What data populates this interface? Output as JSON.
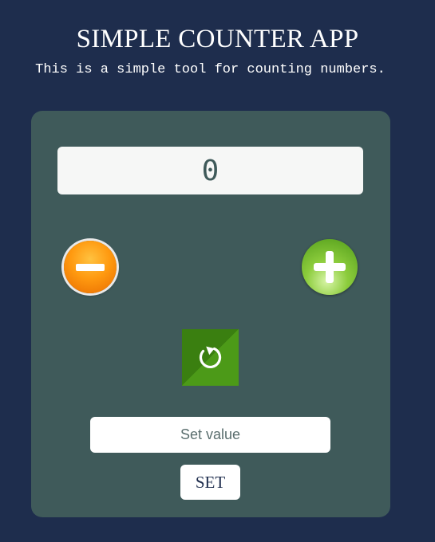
{
  "header": {
    "title": "SIMPLE COUNTER APP",
    "subtitle": "This is a simple tool for counting numbers."
  },
  "counter": {
    "value": "0"
  },
  "controls": {
    "decrement_icon": "minus-icon",
    "increment_icon": "plus-icon",
    "reset_icon": "refresh-icon"
  },
  "set_value": {
    "placeholder": "Set value",
    "value": "",
    "button_label": "SET"
  },
  "colors": {
    "background": "#1e2d4d",
    "card": "#3f5a5a",
    "decrement": "#ff9a10",
    "increment": "#7cc030",
    "reset": "#4c9a18"
  }
}
